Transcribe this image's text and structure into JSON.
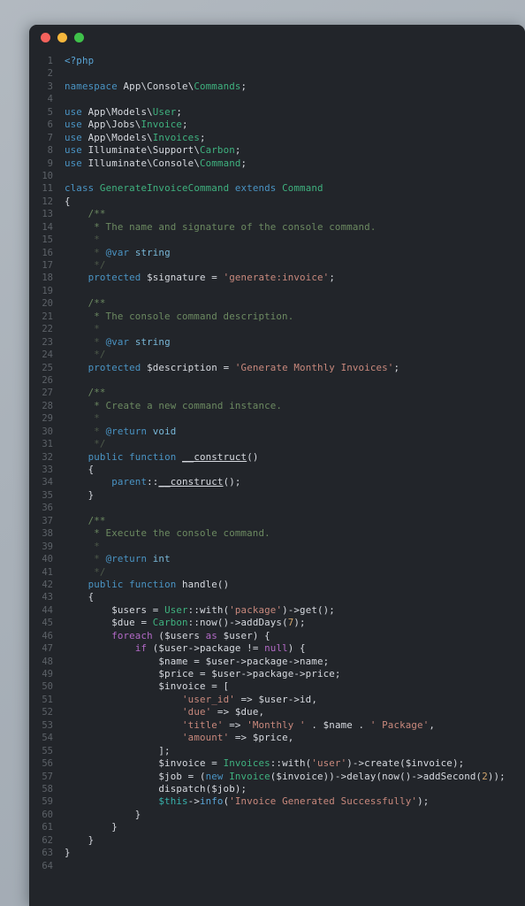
{
  "window": {
    "background_color": "#22252a",
    "desktop_color": "#a9b1b9",
    "controls": [
      {
        "name": "close",
        "color": "#f4625c"
      },
      {
        "name": "minimize",
        "color": "#f6b73c"
      },
      {
        "name": "maximize",
        "color": "#3fc14a"
      }
    ]
  },
  "editor": {
    "language": "php",
    "first_line": 1,
    "last_line": 64,
    "line_numbers": [
      1,
      2,
      3,
      4,
      5,
      6,
      7,
      8,
      9,
      10,
      11,
      12,
      13,
      14,
      15,
      16,
      17,
      18,
      19,
      20,
      21,
      22,
      23,
      24,
      25,
      26,
      27,
      28,
      29,
      30,
      31,
      32,
      33,
      34,
      35,
      36,
      37,
      38,
      39,
      40,
      41,
      42,
      43,
      44,
      45,
      46,
      47,
      48,
      49,
      50,
      51,
      52,
      53,
      54,
      55,
      56,
      57,
      58,
      59,
      60,
      61,
      62,
      63,
      64
    ],
    "colors": {
      "keyword": "#4a94c4",
      "control": "#b36ac7",
      "type": "#3fb27f",
      "string": "#c9897d",
      "comment": "#6c8a61",
      "plain": "#d7dae0",
      "line_number": "#5d6268",
      "method": "#5aa5d6",
      "this": "#38b2ac"
    },
    "lines": [
      "<?php",
      "",
      "namespace App\\Console\\Commands;",
      "",
      "use App\\Models\\User;",
      "use App\\Jobs\\Invoice;",
      "use App\\Models\\Invoices;",
      "use Illuminate\\Support\\Carbon;",
      "use Illuminate\\Console\\Command;",
      "",
      "class GenerateInvoiceCommand extends Command",
      "{",
      "    /**",
      "     * The name and signature of the console command.",
      "     *",
      "     * @var string",
      "     */",
      "    protected $signature = 'generate:invoice';",
      "",
      "    /**",
      "     * The console command description.",
      "     *",
      "     * @var string",
      "     */",
      "    protected $description = 'Generate Monthly Invoices';",
      "",
      "    /**",
      "     * Create a new command instance.",
      "     *",
      "     * @return void",
      "     */",
      "    public function __construct()",
      "    {",
      "        parent::__construct();",
      "    }",
      "",
      "    /**",
      "     * Execute the console command.",
      "     *",
      "     * @return int",
      "     */",
      "    public function handle()",
      "    {",
      "        $users = User::with('package')->get();",
      "        $due = Carbon::now()->addDays(7);",
      "        foreach ($users as $user) {",
      "            if ($user->package != null) {",
      "                $name = $user->package->name;",
      "                $price = $user->package->price;",
      "                $invoice = [",
      "                    'user_id' => $user->id,",
      "                    'due' => $due,",
      "                    'title' => 'Monthly ' . $name . ' Package',",
      "                    'amount' => $price,",
      "                ];",
      "                $invoice = Invoices::with('user')->create($invoice);",
      "                $job = (new Invoice($invoice))->delay(now()->addSecond(2));",
      "                dispatch($job);",
      "                $this->info('Invoice Generated Successfully');",
      "            }",
      "        }",
      "    }",
      "}",
      ""
    ]
  }
}
